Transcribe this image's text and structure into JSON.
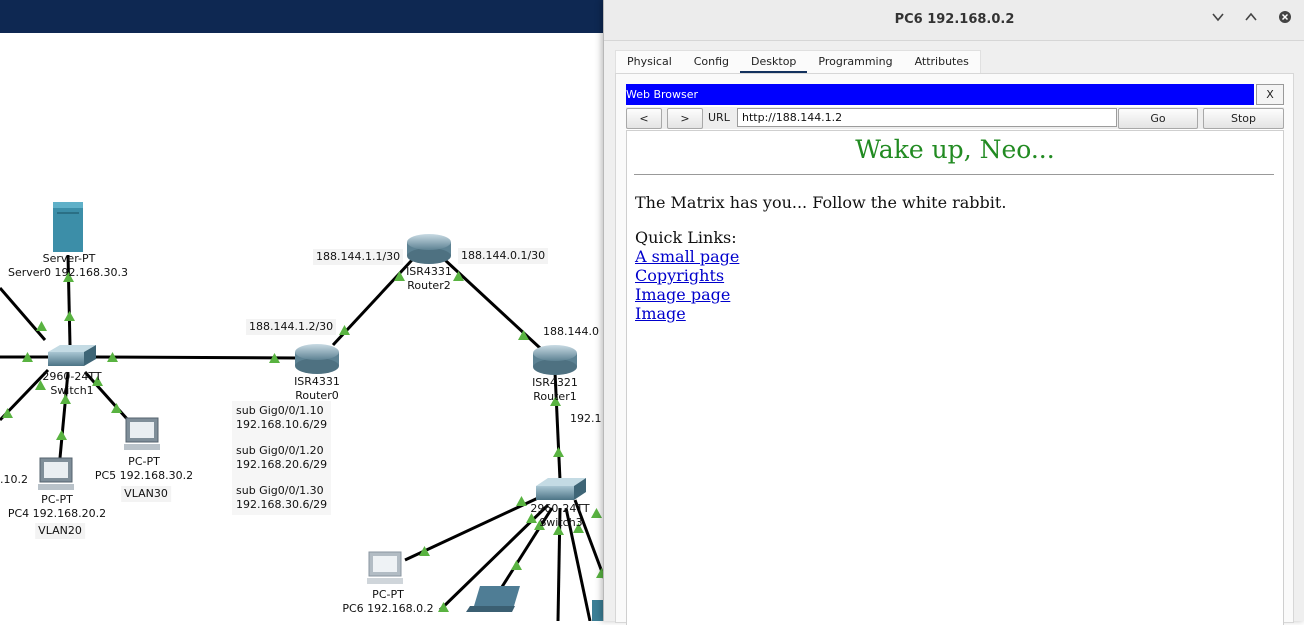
{
  "topology": {
    "server0": {
      "type": "Server-PT",
      "name": "Server0 192.168.30.3"
    },
    "switch1": {
      "type": "2960-24TT",
      "name": "Switch1"
    },
    "switch3": {
      "type": "2960-24TT",
      "name": "Switch3"
    },
    "router0": {
      "type": "ISR4331",
      "name": "Router0"
    },
    "router1": {
      "type": "ISR4321",
      "name": "Router1",
      "partial_ip": "192.1",
      "partial_ip_top": "188.144.0"
    },
    "router2": {
      "type": "ISR4331",
      "name": "Router2"
    },
    "pc4": {
      "type": "PC-PT",
      "name": "PC4 192.168.20.2",
      "vlan": "VLAN20"
    },
    "pc5": {
      "type": "PC-PT",
      "name": "PC5 192.168.30.2",
      "vlan": "VLAN30"
    },
    "pc6": {
      "type": "PC-PT",
      "name": "PC6 192.168.0.2"
    },
    "left_partial_ip": ".10.2",
    "link_labels": {
      "r2_left": "188.144.1.1/30",
      "r2_right": "188.144.0.1/30",
      "r0_top": "188.144.1.2/30"
    },
    "subinterfaces": [
      {
        "name": "sub Gig0/0/1.10",
        "ip": "192.168.10.6/29"
      },
      {
        "name": "sub Gig0/0/1.20",
        "ip": "192.168.20.6/29"
      },
      {
        "name": "sub Gig0/0/1.30",
        "ip": "192.168.30.6/29"
      }
    ]
  },
  "window": {
    "title": "PC6 192.168.0.2",
    "tabs": [
      "Physical",
      "Config",
      "Desktop",
      "Programming",
      "Attributes"
    ],
    "active_tab": "Desktop",
    "minimize_icon": "chevron-down-icon",
    "maximize_icon": "chevron-up-icon",
    "close_icon": "close-icon"
  },
  "browser": {
    "title": "Web Browser",
    "close_label": "X",
    "back_label": "<",
    "forward_label": ">",
    "url_label": "URL",
    "url_value": "http://188.144.1.2",
    "go_label": "Go",
    "stop_label": "Stop",
    "title_bar_color": "#0000ff"
  },
  "webpage": {
    "heading": "Wake up, Neo...",
    "heading_color": "#228b22",
    "body_text": "The Matrix has you... Follow the white rabbit.",
    "quick_links_label": "Quick Links:",
    "links": [
      "A small page",
      "Copyrights",
      "Image page",
      "Image"
    ]
  }
}
